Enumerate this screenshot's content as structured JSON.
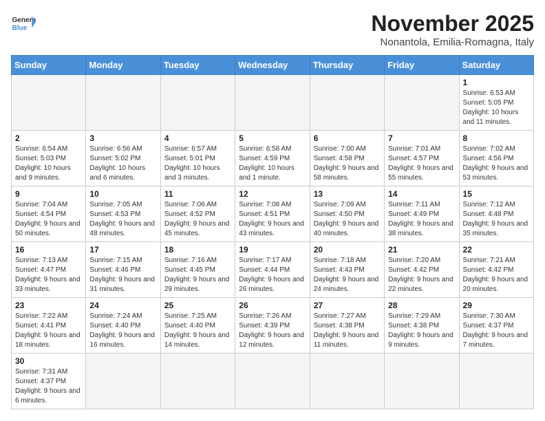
{
  "header": {
    "logo_general": "General",
    "logo_blue": "Blue",
    "month_title": "November 2025",
    "subtitle": "Nonantola, Emilia-Romagna, Italy"
  },
  "days_of_week": [
    "Sunday",
    "Monday",
    "Tuesday",
    "Wednesday",
    "Thursday",
    "Friday",
    "Saturday"
  ],
  "weeks": [
    [
      {
        "day": "",
        "info": ""
      },
      {
        "day": "",
        "info": ""
      },
      {
        "day": "",
        "info": ""
      },
      {
        "day": "",
        "info": ""
      },
      {
        "day": "",
        "info": ""
      },
      {
        "day": "",
        "info": ""
      },
      {
        "day": "1",
        "info": "Sunrise: 6:53 AM\nSunset: 5:05 PM\nDaylight: 10 hours and 11 minutes."
      }
    ],
    [
      {
        "day": "2",
        "info": "Sunrise: 6:54 AM\nSunset: 5:03 PM\nDaylight: 10 hours and 9 minutes."
      },
      {
        "day": "3",
        "info": "Sunrise: 6:56 AM\nSunset: 5:02 PM\nDaylight: 10 hours and 6 minutes."
      },
      {
        "day": "4",
        "info": "Sunrise: 6:57 AM\nSunset: 5:01 PM\nDaylight: 10 hours and 3 minutes."
      },
      {
        "day": "5",
        "info": "Sunrise: 6:58 AM\nSunset: 4:59 PM\nDaylight: 10 hours and 1 minute."
      },
      {
        "day": "6",
        "info": "Sunrise: 7:00 AM\nSunset: 4:58 PM\nDaylight: 9 hours and 58 minutes."
      },
      {
        "day": "7",
        "info": "Sunrise: 7:01 AM\nSunset: 4:57 PM\nDaylight: 9 hours and 55 minutes."
      },
      {
        "day": "8",
        "info": "Sunrise: 7:02 AM\nSunset: 4:56 PM\nDaylight: 9 hours and 53 minutes."
      }
    ],
    [
      {
        "day": "9",
        "info": "Sunrise: 7:04 AM\nSunset: 4:54 PM\nDaylight: 9 hours and 50 minutes."
      },
      {
        "day": "10",
        "info": "Sunrise: 7:05 AM\nSunset: 4:53 PM\nDaylight: 9 hours and 48 minutes."
      },
      {
        "day": "11",
        "info": "Sunrise: 7:06 AM\nSunset: 4:52 PM\nDaylight: 9 hours and 45 minutes."
      },
      {
        "day": "12",
        "info": "Sunrise: 7:08 AM\nSunset: 4:51 PM\nDaylight: 9 hours and 43 minutes."
      },
      {
        "day": "13",
        "info": "Sunrise: 7:09 AM\nSunset: 4:50 PM\nDaylight: 9 hours and 40 minutes."
      },
      {
        "day": "14",
        "info": "Sunrise: 7:11 AM\nSunset: 4:49 PM\nDaylight: 9 hours and 38 minutes."
      },
      {
        "day": "15",
        "info": "Sunrise: 7:12 AM\nSunset: 4:48 PM\nDaylight: 9 hours and 35 minutes."
      }
    ],
    [
      {
        "day": "16",
        "info": "Sunrise: 7:13 AM\nSunset: 4:47 PM\nDaylight: 9 hours and 33 minutes."
      },
      {
        "day": "17",
        "info": "Sunrise: 7:15 AM\nSunset: 4:46 PM\nDaylight: 9 hours and 31 minutes."
      },
      {
        "day": "18",
        "info": "Sunrise: 7:16 AM\nSunset: 4:45 PM\nDaylight: 9 hours and 29 minutes."
      },
      {
        "day": "19",
        "info": "Sunrise: 7:17 AM\nSunset: 4:44 PM\nDaylight: 9 hours and 26 minutes."
      },
      {
        "day": "20",
        "info": "Sunrise: 7:18 AM\nSunset: 4:43 PM\nDaylight: 9 hours and 24 minutes."
      },
      {
        "day": "21",
        "info": "Sunrise: 7:20 AM\nSunset: 4:42 PM\nDaylight: 9 hours and 22 minutes."
      },
      {
        "day": "22",
        "info": "Sunrise: 7:21 AM\nSunset: 4:42 PM\nDaylight: 9 hours and 20 minutes."
      }
    ],
    [
      {
        "day": "23",
        "info": "Sunrise: 7:22 AM\nSunset: 4:41 PM\nDaylight: 9 hours and 18 minutes."
      },
      {
        "day": "24",
        "info": "Sunrise: 7:24 AM\nSunset: 4:40 PM\nDaylight: 9 hours and 16 minutes."
      },
      {
        "day": "25",
        "info": "Sunrise: 7:25 AM\nSunset: 4:40 PM\nDaylight: 9 hours and 14 minutes."
      },
      {
        "day": "26",
        "info": "Sunrise: 7:26 AM\nSunset: 4:39 PM\nDaylight: 9 hours and 12 minutes."
      },
      {
        "day": "27",
        "info": "Sunrise: 7:27 AM\nSunset: 4:38 PM\nDaylight: 9 hours and 11 minutes."
      },
      {
        "day": "28",
        "info": "Sunrise: 7:29 AM\nSunset: 4:38 PM\nDaylight: 9 hours and 9 minutes."
      },
      {
        "day": "29",
        "info": "Sunrise: 7:30 AM\nSunset: 4:37 PM\nDaylight: 9 hours and 7 minutes."
      }
    ],
    [
      {
        "day": "30",
        "info": "Sunrise: 7:31 AM\nSunset: 4:37 PM\nDaylight: 9 hours and 6 minutes."
      },
      {
        "day": "",
        "info": ""
      },
      {
        "day": "",
        "info": ""
      },
      {
        "day": "",
        "info": ""
      },
      {
        "day": "",
        "info": ""
      },
      {
        "day": "",
        "info": ""
      },
      {
        "day": "",
        "info": ""
      }
    ]
  ]
}
